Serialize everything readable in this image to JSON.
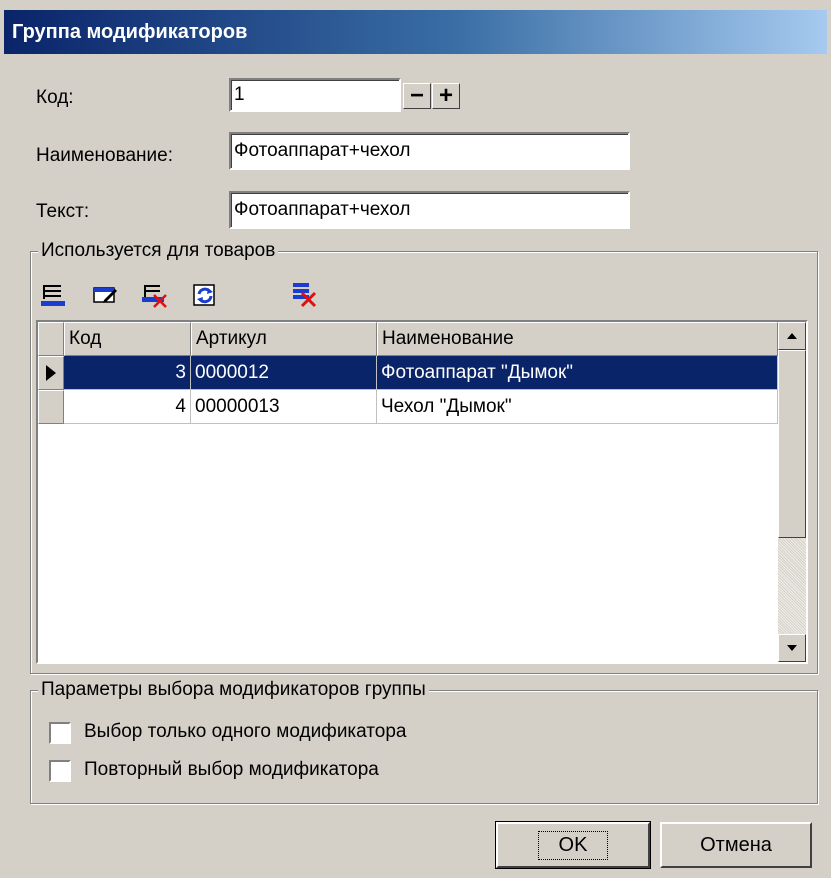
{
  "window": {
    "title": "Группа модификаторов"
  },
  "form": {
    "code_label": "Код:",
    "code_value": "1",
    "spin_minus": "−",
    "spin_plus": "+",
    "name_label": "Наименование:",
    "name_value": "Фотоаппарат+чехол",
    "text_label": "Текст:",
    "text_value": "Фотоаппарат+чехол"
  },
  "products_group": {
    "title": "Используется для товаров",
    "toolbar": [
      "add-row-icon",
      "edit-row-icon",
      "delete-row-icon",
      "refresh-icon",
      "delete-all-icon"
    ],
    "columns": [
      "Код",
      "Артикул",
      "Наименование"
    ],
    "rows": [
      {
        "code": "3",
        "article": "0000012",
        "name": "Фотоаппарат \"Дымок\"",
        "selected": true
      },
      {
        "code": "4",
        "article": "00000013",
        "name": "Чехол \"Дымок\"",
        "selected": false
      }
    ]
  },
  "params_group": {
    "title": "Параметры выбора модификаторов группы",
    "single_modifier_label": "Выбор только одного модификатора",
    "single_modifier_checked": false,
    "repeat_select_label": "Повторный выбор модификатора",
    "repeat_select_checked": false
  },
  "buttons": {
    "ok": "OK",
    "cancel": "Отмена"
  },
  "colors": {
    "selection": "#0a246a",
    "face": "#d4d0c8",
    "title_start": "#0a246a",
    "title_end": "#a6caf0"
  }
}
